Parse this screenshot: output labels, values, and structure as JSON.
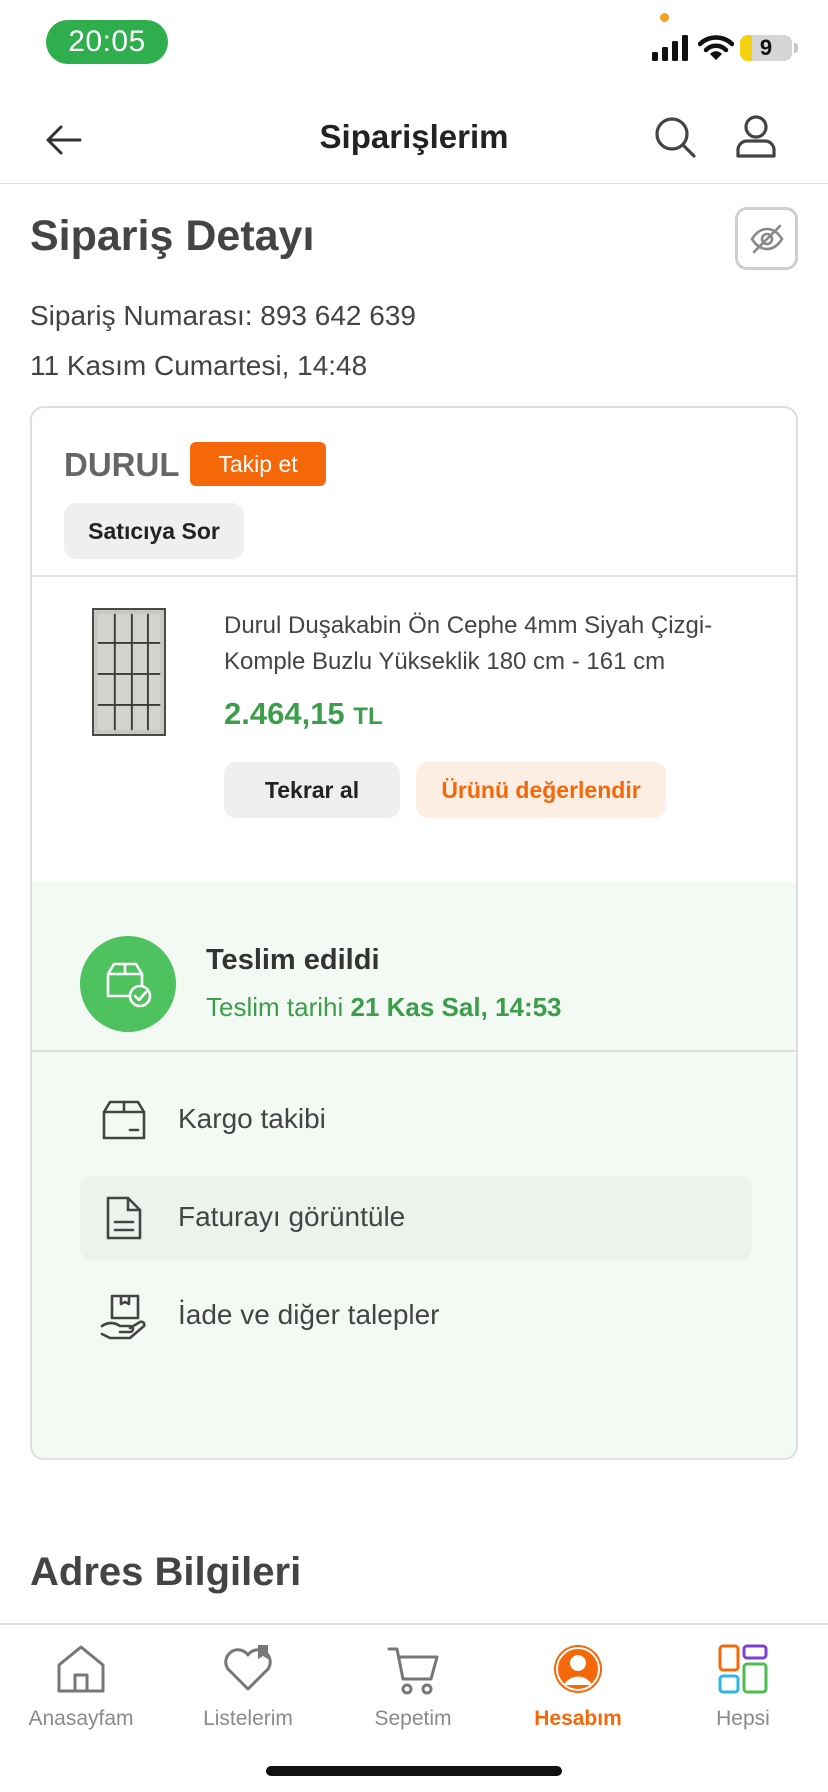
{
  "status_bar": {
    "time": "20:05",
    "battery": "9"
  },
  "header": {
    "title": "Siparişlerim"
  },
  "order": {
    "title": "Sipariş Detayı",
    "number_line": "Sipariş Numarası: 893 642 639",
    "date_line": "11 Kasım Cumartesi, 14:48"
  },
  "seller": {
    "name": "DURUL",
    "follow_label": "Takip et",
    "ask_label": "Satıcıya Sor"
  },
  "product": {
    "name": "Durul Duşakabin Ön Cephe 4mm Siyah Çizgi-Komple Buzlu Yükseklik 180 cm - 161 cm",
    "price": "2.464,15",
    "currency": "TL",
    "buy_again_label": "Tekrar al",
    "rate_label": "Ürünü değerlendir"
  },
  "delivery": {
    "status": "Teslim edildi",
    "date_prefix": "Teslim tarihi",
    "date_value": "21 Kas Sal, 14:53"
  },
  "actions": [
    {
      "label": "Kargo takibi",
      "icon": "box-icon"
    },
    {
      "label": "Faturayı görüntüle",
      "icon": "invoice-icon"
    },
    {
      "label": "İade ve diğer talepler",
      "icon": "return-hand-icon"
    }
  ],
  "address": {
    "title": "Adres Bilgileri"
  },
  "nav": [
    {
      "label": "Anasayfam",
      "icon": "home-icon"
    },
    {
      "label": "Listelerim",
      "icon": "heart-bookmark-icon"
    },
    {
      "label": "Sepetim",
      "icon": "cart-icon"
    },
    {
      "label": "Hesabım",
      "icon": "account-icon",
      "active": true
    },
    {
      "label": "Hepsi",
      "icon": "grid-icon"
    }
  ],
  "colors": {
    "accent": "#f4680a",
    "success": "#3c9e4a",
    "status_circle": "#4dc25e",
    "time_pill": "#2fae4e"
  }
}
